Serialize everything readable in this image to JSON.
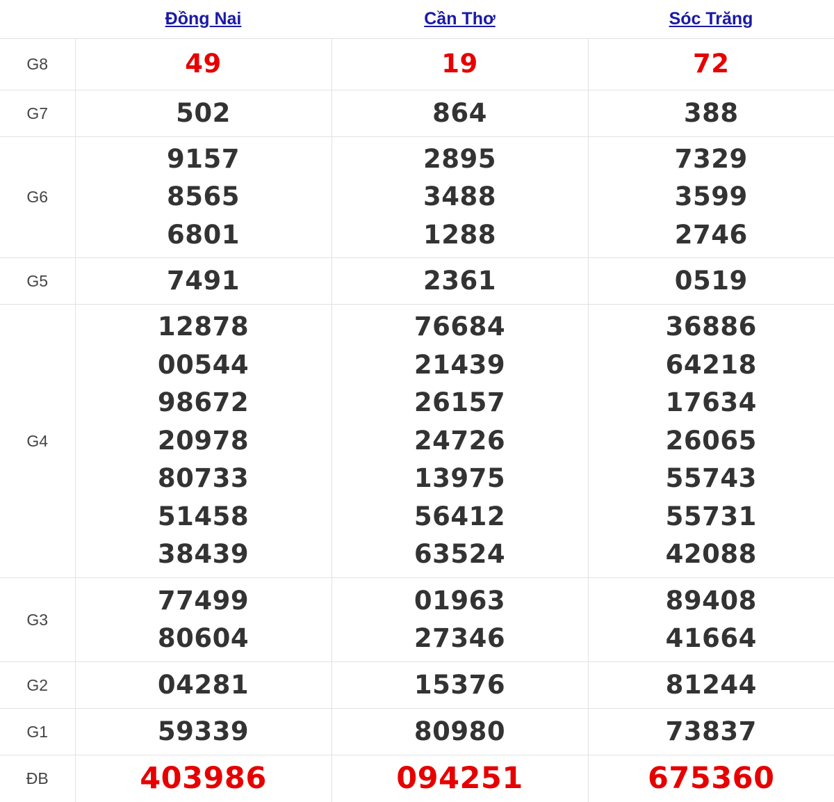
{
  "provinces": [
    "Đồng Nai",
    "Cần Thơ",
    "Sóc Trăng"
  ],
  "rows": [
    {
      "label": "G8",
      "style": "red",
      "values": [
        [
          "49"
        ],
        [
          "19"
        ],
        [
          "72"
        ]
      ]
    },
    {
      "label": "G7",
      "style": "normal",
      "values": [
        [
          "502"
        ],
        [
          "864"
        ],
        [
          "388"
        ]
      ]
    },
    {
      "label": "G6",
      "style": "normal",
      "values": [
        [
          "9157",
          "8565",
          "6801"
        ],
        [
          "2895",
          "3488",
          "1288"
        ],
        [
          "7329",
          "3599",
          "2746"
        ]
      ]
    },
    {
      "label": "G5",
      "style": "normal",
      "values": [
        [
          "7491"
        ],
        [
          "2361"
        ],
        [
          "0519"
        ]
      ]
    },
    {
      "label": "G4",
      "style": "normal",
      "values": [
        [
          "12878",
          "00544",
          "98672",
          "20978",
          "80733",
          "51458",
          "38439"
        ],
        [
          "76684",
          "21439",
          "26157",
          "24726",
          "13975",
          "56412",
          "63524"
        ],
        [
          "36886",
          "64218",
          "17634",
          "26065",
          "55743",
          "55731",
          "42088"
        ]
      ]
    },
    {
      "label": "G3",
      "style": "normal",
      "values": [
        [
          "77499",
          "80604"
        ],
        [
          "01963",
          "27346"
        ],
        [
          "89408",
          "41664"
        ]
      ]
    },
    {
      "label": "G2",
      "style": "normal",
      "values": [
        [
          "04281"
        ],
        [
          "15376"
        ],
        [
          "81244"
        ]
      ]
    },
    {
      "label": "G1",
      "style": "normal",
      "values": [
        [
          "59339"
        ],
        [
          "80980"
        ],
        [
          "73837"
        ]
      ]
    },
    {
      "label": "ĐB",
      "style": "red-big",
      "values": [
        [
          "403986"
        ],
        [
          "094251"
        ],
        [
          "675360"
        ]
      ]
    }
  ],
  "colors": {
    "accent_red": "#e60000",
    "link_blue": "#1a1aa6",
    "text": "#333333",
    "border": "#e2e2e2"
  }
}
